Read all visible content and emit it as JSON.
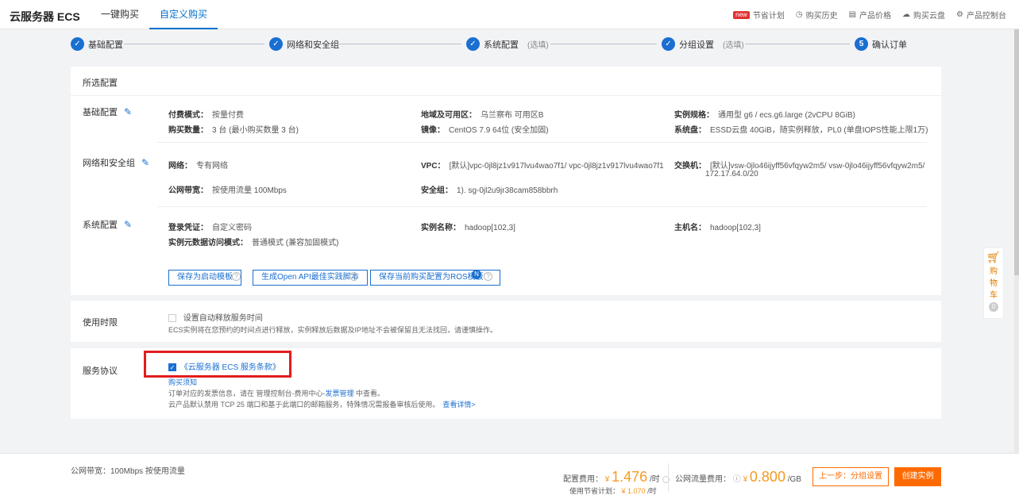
{
  "header": {
    "brand": "云服务器 ECS",
    "tabs": [
      {
        "label": "一键购买"
      },
      {
        "label": "自定义购买"
      }
    ],
    "links": [
      {
        "label": "节省计划",
        "badge": "new"
      },
      {
        "label": "购买历史"
      },
      {
        "label": "产品价格"
      },
      {
        "label": "购买云盘"
      },
      {
        "label": "产品控制台"
      }
    ]
  },
  "steps": [
    {
      "label": "基础配置",
      "opt": ""
    },
    {
      "label": "网络和安全组",
      "opt": ""
    },
    {
      "label": "系统配置",
      "opt": "(选填)"
    },
    {
      "label": "分组设置",
      "opt": "(选填)"
    },
    {
      "label": "确认订单",
      "opt": "",
      "num": "5"
    }
  ],
  "summary": {
    "title": "所选配置",
    "basic": {
      "title": "基础配置",
      "billing_label": "付费模式：",
      "billing": "按量付费",
      "qty_label": "购买数量：",
      "qty": "3 台 (最小购买数量 3 台)",
      "region_label": "地域及可用区：",
      "region": "乌兰察布 可用区B",
      "image_label": "镜像：",
      "image": "CentOS 7.9 64位 (安全加固)",
      "spec_label": "实例规格：",
      "spec": "通用型 g6 / ecs.g6.large (2vCPU 8GiB)",
      "disk_label": "系统盘：",
      "disk": "ESSD云盘 40GiB，随实例释放，PL0 (单盘IOPS性能上限1万)"
    },
    "network": {
      "title": "网络和安全组",
      "net_label": "网络：",
      "net": "专有网络",
      "bw_label": "公网带宽：",
      "bw": "按使用流量 100Mbps",
      "vpc_label": "VPC：",
      "vpc": "[默认]vpc-0jl8jz1v917lvu4wao7f1/ vpc-0jl8jz1v917lvu4wao7f1",
      "sg_label": "安全组：",
      "sg": "1). sg-0jl2u9jr38cam858bbrh",
      "vsw_label": "交换机：",
      "vsw": "[默认]vsw-0jlo46ijyff56vfqyw2m5/ vsw-0jlo46ijyff56vfqyw2m5/",
      "vsw2": "172.17.64.0/20"
    },
    "system": {
      "title": "系统配置",
      "cred_label": "登录凭证：",
      "cred": "自定义密码",
      "meta_label": "实例元数据访问模式：",
      "meta": "普通模式 (兼容加固模式)",
      "name_label": "实例名称：",
      "name": "hadoop[102,3]",
      "host_label": "主机名：",
      "host": "hadoop[102,3]"
    },
    "buttons": {
      "save_tpl": "保存为启动模板",
      "gen_api": "生成Open API最佳实践脚本",
      "save_ros": "保存当前购买配置为ROS模板"
    }
  },
  "duration": {
    "title": "使用时限",
    "auto_release": "设置自动释放服务时间",
    "note": "ECS实例将在您预约的时间点进行释放，实例释放后数据及IP地址不会被保留且无法找回，请谨慎操作。"
  },
  "agreement": {
    "title": "服务协议",
    "terms": "《云服务器 ECS 服务条款》",
    "notice": "购买须知",
    "line1_pre": "订单对应的发票信息，请在 管理控制台-费用中心-",
    "line1_link": "发票管理",
    "line1_post": " 中查看。",
    "line2": "云产品默认禁用 TCP 25 端口和基于此端口的邮箱服务，特殊情况需报备审核后使用。",
    "line2_link": "查看详情>"
  },
  "cart": {
    "label1": "购",
    "label2": "物",
    "label3": "车",
    "count": "0"
  },
  "footer": {
    "bandwidth": "公网带宽：100Mbps 按使用流量",
    "config_label": "配置费用：",
    "config_price": "1.476",
    "config_unit": "/时",
    "currency": "¥",
    "saving_label": "使用节省计划：",
    "saving_price": "¥ 1.070",
    "saving_unit": "/时",
    "traffic_label": "公网流量费用：",
    "traffic_price": "0.800",
    "traffic_unit": "/GB",
    "prev_button": "上一步：分组设置",
    "create_button": "创建实例"
  },
  "colors": {
    "accent": "#1a6fd1",
    "price": "#f59a23",
    "create": "#ff6a00",
    "alert": "#e11d1d"
  }
}
